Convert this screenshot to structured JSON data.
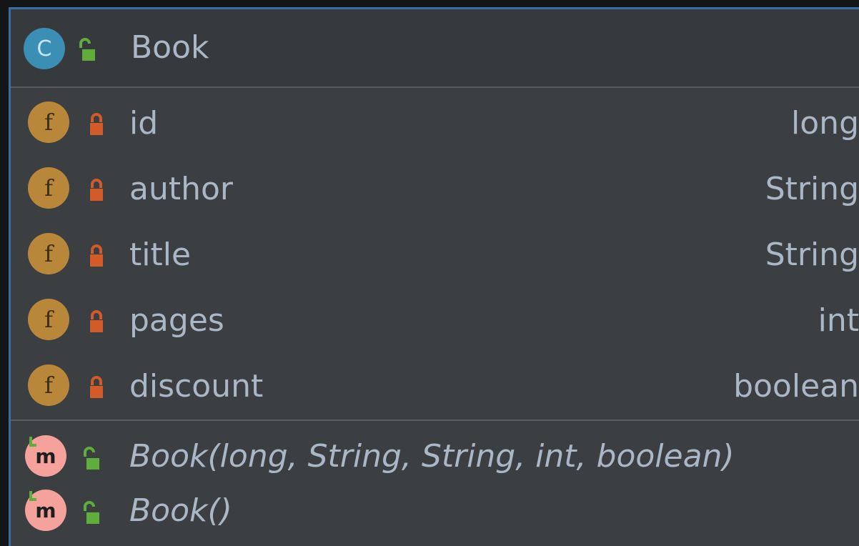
{
  "class": {
    "name": "Book",
    "kind_letter": "C",
    "visibility": "public",
    "icon": "class-icon"
  },
  "fields": [
    {
      "name": "id",
      "type": "long",
      "kind_letter": "f",
      "visibility": "private"
    },
    {
      "name": "author",
      "type": "String",
      "kind_letter": "f",
      "visibility": "private"
    },
    {
      "name": "title",
      "type": "String",
      "kind_letter": "f",
      "visibility": "private"
    },
    {
      "name": "pages",
      "type": "int",
      "kind_letter": "f",
      "visibility": "private"
    },
    {
      "name": "discount",
      "type": "boolean",
      "kind_letter": "f",
      "visibility": "private"
    }
  ],
  "methods": [
    {
      "signature": "Book(long, String, String, int, boolean)",
      "kind_letter": "m",
      "visibility": "public"
    },
    {
      "signature": "Book()",
      "kind_letter": "m",
      "visibility": "public"
    }
  ],
  "colors": {
    "background": "#3c3f41",
    "header": "#373a3c",
    "text": "#a9b7c6",
    "class_icon": "#3b8fb5",
    "field_icon": "#b9873a",
    "method_icon": "#f4a29b",
    "private_lock": "#d25b2a",
    "public_lock": "#5fae3c",
    "selection_border": "#3a6da3"
  }
}
